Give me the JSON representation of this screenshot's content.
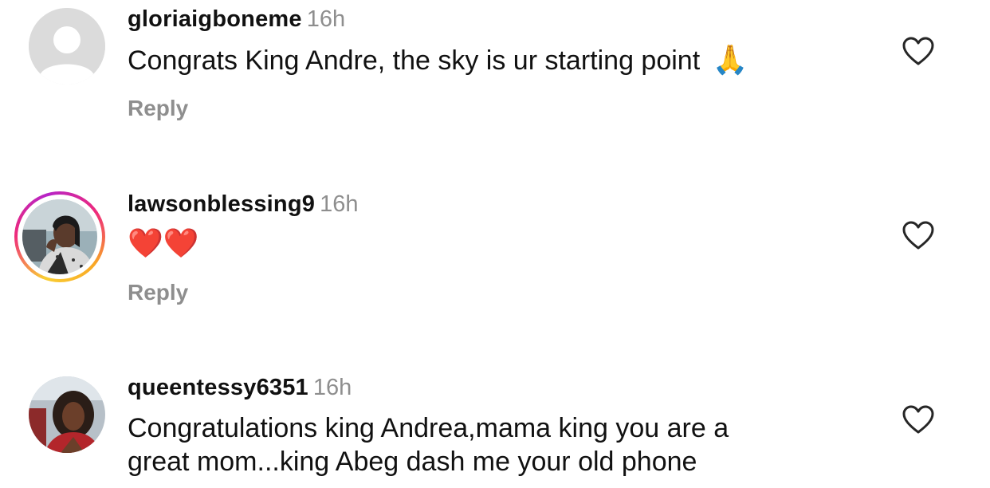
{
  "comments": [
    {
      "username": "gloriaigboneme",
      "time": "16h",
      "text": "Congrats King Andre, the sky is ur starting point",
      "emoji": "🙏",
      "reply_label": "Reply",
      "avatar": "default-avatar"
    },
    {
      "username": "lawsonblessing9",
      "time": "16h",
      "text": "",
      "emoji": "❤️❤️",
      "reply_label": "Reply",
      "avatar": "story-ring-photo"
    },
    {
      "username": "queentessy6351",
      "time": "16h",
      "text_line1": "Congratulations king Andrea,mama king  you are a",
      "text_line2": "great mom...king Abeg dash me your old phone",
      "avatar": "photo"
    }
  ],
  "icons": {
    "like": "heart-outline-icon"
  },
  "colors": {
    "secondary_text": "#8e8e8e",
    "primary_text": "#111111",
    "heart_red": "#e0242f"
  }
}
